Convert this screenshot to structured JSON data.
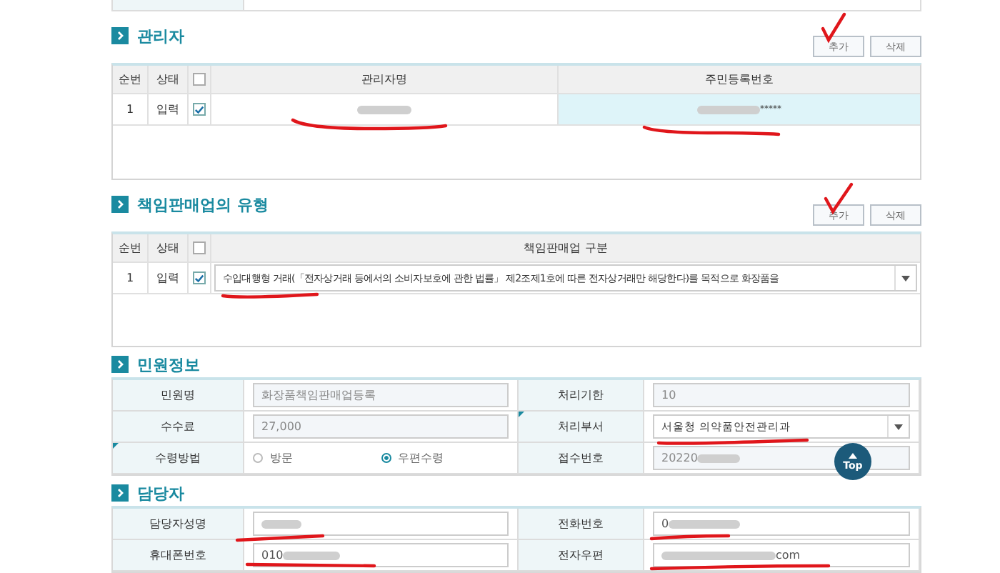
{
  "managers": {
    "title": "관리자",
    "buttons": [
      "추가",
      "삭제"
    ],
    "columns": [
      "순번",
      "상태",
      "",
      "관리자명",
      "주민등록번호"
    ],
    "header_checked": false,
    "rows": [
      {
        "no": "1",
        "status": "입력",
        "checked": true,
        "id_number": "*****"
      }
    ]
  },
  "business_type": {
    "title": "책임판매업의 유형",
    "buttons": [
      "추가",
      "삭제"
    ],
    "columns": [
      "순번",
      "상태",
      "",
      "책임판매업 구분"
    ],
    "header_checked": false,
    "rows": [
      {
        "no": "1",
        "status": "입력",
        "checked": true,
        "type": "수입대행형 거래(「전자상거래 등에서의 소비자보호에 관한 법률」 제2조제1호에 따른 전자상거래만 해당한다)를 목적으로 화장품을"
      }
    ]
  },
  "complaint_info": {
    "title": "민원정보",
    "name_label": "민원명",
    "name": "화장품책임판매업등록",
    "deadline_label": "처리기한",
    "deadline": "10",
    "fee_label": "수수료",
    "fee": "27,000",
    "dept_label": "처리부서",
    "dept": "서울청 의약품안전관리과",
    "method_label": "수령방법",
    "methods": [
      {
        "label": "방문",
        "selected": false
      },
      {
        "label": "우편수령",
        "selected": true
      }
    ],
    "receipt_label": "접수번호",
    "receipt": "20220"
  },
  "contact": {
    "title": "담당자",
    "name_label": "담당자성명",
    "phone_label": "전화번호",
    "phone": "0",
    "mobile_label": "휴대폰번호",
    "mobile": "010",
    "email_label": "전자우편",
    "email": "com"
  },
  "top_button": "Top"
}
